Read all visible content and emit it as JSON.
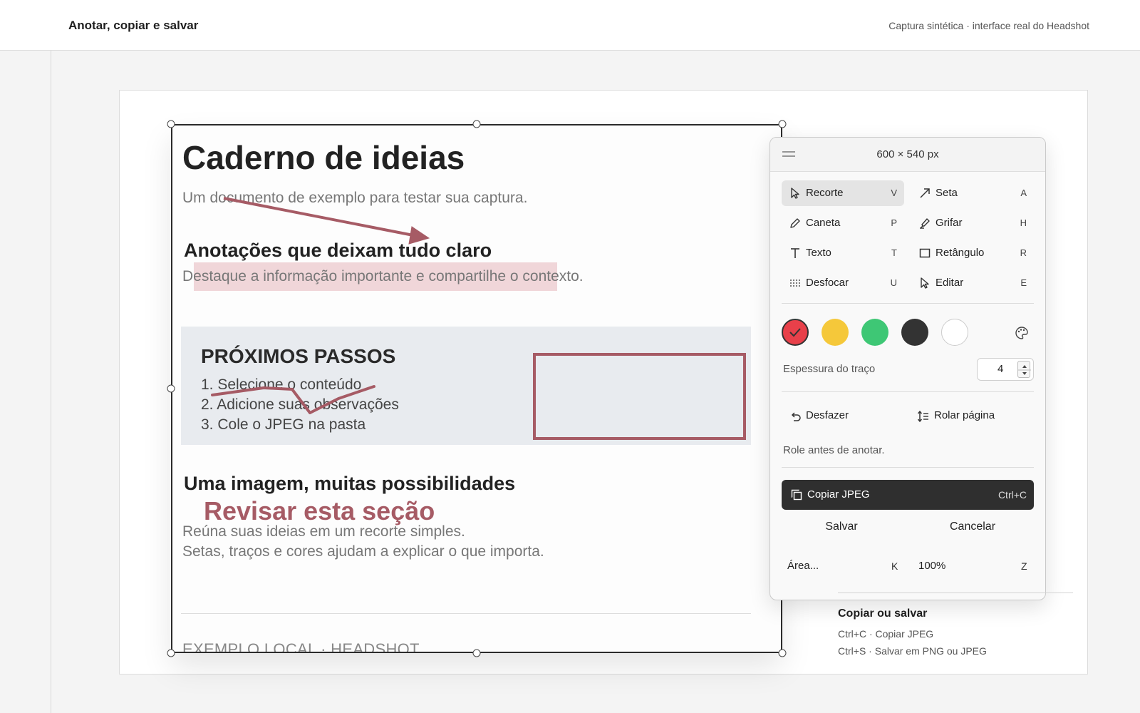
{
  "header": {
    "title": "Anotar, copiar e salvar",
    "caption": "Captura sintética · interface real do Headshot"
  },
  "document": {
    "title": "Caderno de ideias",
    "subtitle": "Um documento de exemplo para testar sua captura.",
    "section1_heading": "Anotações que deixam tudo claro",
    "section1_text": "Destaque a informação importante e compartilhe o contexto.",
    "steps_title": "PRÓXIMOS PASSOS",
    "steps": [
      "1. Selecione o conteúdo",
      "2. Adicione suas observações",
      "3. Cole o JPEG na pasta"
    ],
    "section2_heading": "Uma imagem, muitas possibilidades",
    "review_annotation": "Revisar esta seção",
    "section2_lines": [
      "Reúna suas ideias em um recorte simples.",
      "Setas, traços e cores ajudam a explicar o que importa."
    ],
    "footer": "EXEMPLO LOCAL  ·  HEADSHOT"
  },
  "annotation_color": "#a65b65",
  "panel": {
    "dimensions": "600 × 540 px",
    "tools": [
      {
        "label": "Recorte",
        "key": "V",
        "icon": "pointer-icon",
        "active": true
      },
      {
        "label": "Seta",
        "key": "A",
        "icon": "arrow-icon",
        "active": false
      },
      {
        "label": "Caneta",
        "key": "P",
        "icon": "pen-icon",
        "active": false
      },
      {
        "label": "Grifar",
        "key": "H",
        "icon": "highlighter-icon",
        "active": false
      },
      {
        "label": "Texto",
        "key": "T",
        "icon": "text-icon",
        "active": false
      },
      {
        "label": "Retângulo",
        "key": "R",
        "icon": "rectangle-icon",
        "active": false
      },
      {
        "label": "Desfocar",
        "key": "U",
        "icon": "blur-icon",
        "active": false
      },
      {
        "label": "Editar",
        "key": "E",
        "icon": "edit-cursor-icon",
        "active": false
      }
    ],
    "colors": [
      "#e8404a",
      "#f5c83a",
      "#3ec775",
      "#333333",
      "#ffffff"
    ],
    "selected_color": "#e8404a",
    "stroke_label": "Espessura do traço",
    "stroke_value": "4",
    "undo_label": "Desfazer",
    "scroll_label": "Rolar página",
    "hint": "Role antes de anotar.",
    "copy_label": "Copiar JPEG",
    "copy_shortcut": "Ctrl+C",
    "save_label": "Salvar",
    "cancel_label": "Cancelar",
    "area_label": "Área...",
    "area_key": "K",
    "zoom_label": "100%",
    "zoom_key": "Z"
  },
  "side_note": {
    "title": "Copiar ou salvar",
    "lines": [
      "Ctrl+C · Copiar JPEG",
      "Ctrl+S · Salvar em PNG ou JPEG"
    ]
  }
}
